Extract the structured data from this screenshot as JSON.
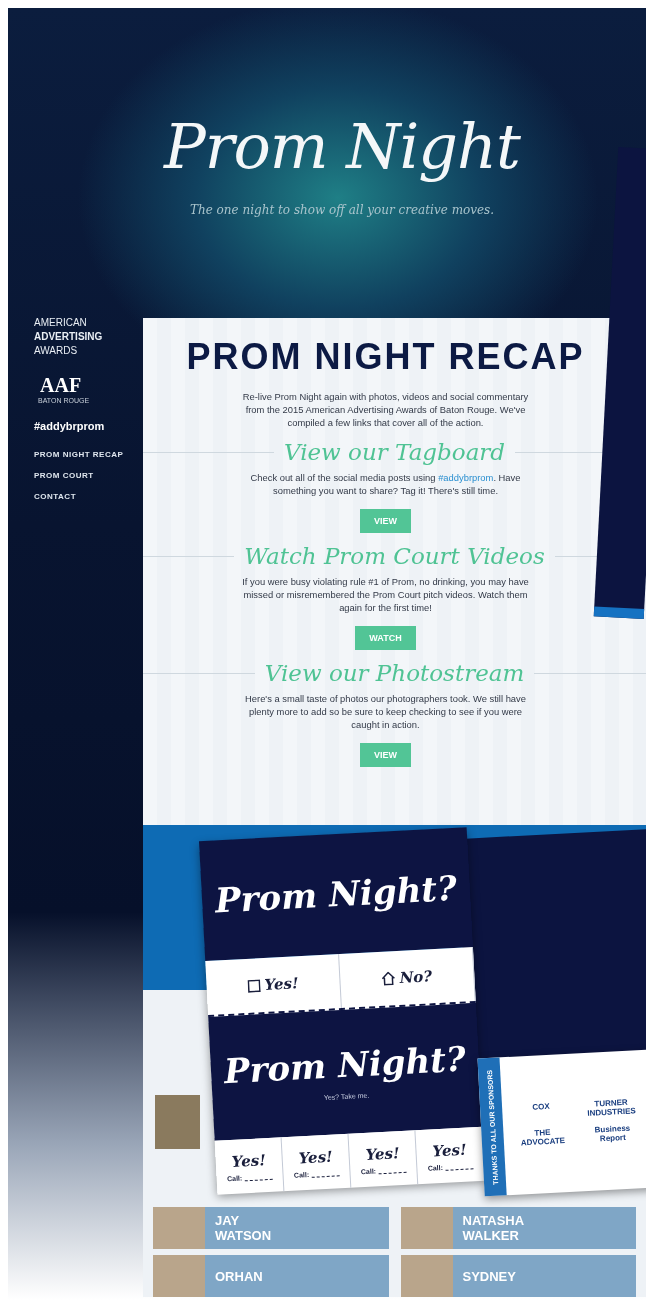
{
  "header": {
    "logo": "Prom Night",
    "tagline": "The one night to show off all your creative moves."
  },
  "sidebar": {
    "logo_lines": [
      "AMERICAN",
      "ADVERTISING",
      "AWARDS"
    ],
    "badge": {
      "mark": "AAF",
      "caption": "BATON ROUGE"
    },
    "hashtag": "#addybrprom",
    "nav": [
      {
        "label": "PROM NIGHT RECAP"
      },
      {
        "label": "PROM COURT"
      },
      {
        "label": "CONTACT"
      }
    ]
  },
  "recap": {
    "title": "PROM NIGHT RECAP",
    "intro": "Re-live Prom Night again with photos, videos and social commentary from the 2015 American Advertising Awards of Baton Rouge. We've compiled a few links that cover all of the action.",
    "sections": [
      {
        "heading": "View our Tagboard",
        "parts": [
          {
            "kind": "text",
            "text": "Check out all of the social media posts using "
          },
          {
            "kind": "link",
            "text": "#addybrprom"
          },
          {
            "kind": "text",
            "text": ". Have something you want to share? Tag it! There's still time."
          }
        ],
        "button": "VIEW"
      },
      {
        "heading": "Watch Prom Court Videos",
        "parts": [
          {
            "kind": "text",
            "text": "If you were busy violating rule #1 of Prom, no drinking, you may have missed or misremembered the Prom Court pitch videos. Watch them again for the first time!"
          }
        ],
        "button": "WATCH"
      },
      {
        "heading": "View our Photostream",
        "parts": [
          {
            "kind": "text",
            "text": "Here's a small taste of photos our photographers took. We still have plenty more to add so be sure to keep checking to see if you were caught in action."
          }
        ],
        "button": "VIEW"
      }
    ]
  },
  "flyer": {
    "title": "Prom Night?",
    "options": [
      {
        "kind": "checkbox",
        "label": "Yes!"
      },
      {
        "kind": "house",
        "label": "No?"
      }
    ],
    "title_2": "Prom Night?",
    "prompt": "Yes? Take me.",
    "tickets": [
      {
        "label": "Yes!",
        "call": "Call:"
      },
      {
        "label": "Yes!",
        "call": "Call:"
      },
      {
        "label": "Yes!",
        "call": "Call:"
      },
      {
        "label": "Yes!",
        "call": "Call:"
      }
    ]
  },
  "sponsors": {
    "caption": "THANKS TO ALL OUR SPONSORS",
    "logos": [
      "COX",
      "TURNER INDUSTRIES",
      "THE ADVOCATE",
      "Business Report"
    ]
  },
  "court": [
    {
      "first": "JAY",
      "last": "WATSON"
    },
    {
      "first": "NATASHA",
      "last": "WALKER"
    },
    {
      "first": "ORHAN"
    },
    {
      "first": "SYDNEY"
    }
  ]
}
